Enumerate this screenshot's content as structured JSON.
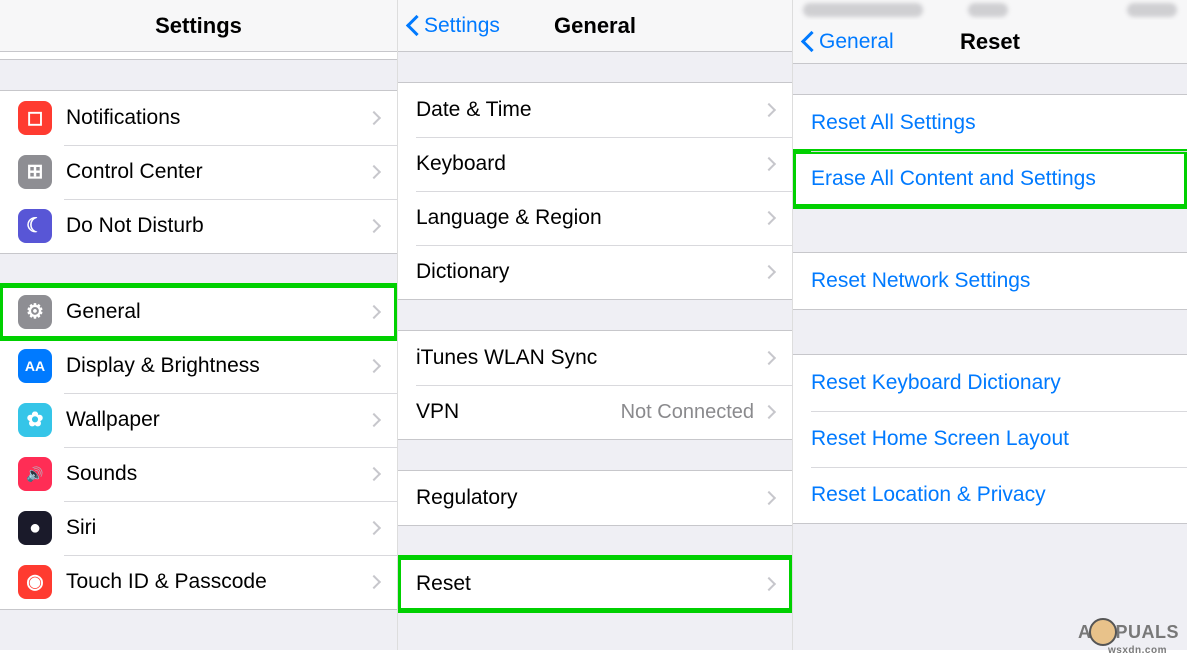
{
  "panel1": {
    "title": "Settings",
    "group1": [
      {
        "icon": "notifications-icon",
        "color": "#ff3b30",
        "glyph": "◻",
        "label": "Notifications"
      },
      {
        "icon": "control-center-icon",
        "color": "#8e8e93",
        "glyph": "⊞",
        "label": "Control Center"
      },
      {
        "icon": "dnd-icon",
        "color": "#5856d6",
        "glyph": "☾",
        "label": "Do Not Disturb"
      }
    ],
    "group2": [
      {
        "icon": "general-icon",
        "color": "#8e8e93",
        "glyph": "⚙",
        "label": "General",
        "highlight": true
      },
      {
        "icon": "display-icon",
        "color": "#007aff",
        "glyph": "AA",
        "label": "Display & Brightness"
      },
      {
        "icon": "wallpaper-icon",
        "color": "#35c5e8",
        "glyph": "✿",
        "label": "Wallpaper"
      },
      {
        "icon": "sounds-icon",
        "color": "#ff2d55",
        "glyph": "🔊",
        "label": "Sounds"
      },
      {
        "icon": "siri-icon",
        "color": "#1a1a2a",
        "glyph": "●",
        "label": "Siri"
      },
      {
        "icon": "touchid-icon",
        "color": "#ff3b30",
        "glyph": "◉",
        "label": "Touch ID & Passcode"
      }
    ]
  },
  "panel2": {
    "back": "Settings",
    "title": "General",
    "group1": [
      {
        "label": "Date & Time"
      },
      {
        "label": "Keyboard"
      },
      {
        "label": "Language & Region"
      },
      {
        "label": "Dictionary"
      }
    ],
    "group2": [
      {
        "label": "iTunes WLAN Sync"
      },
      {
        "label": "VPN",
        "value": "Not Connected"
      }
    ],
    "group3": [
      {
        "label": "Regulatory"
      }
    ],
    "group4": [
      {
        "label": "Reset",
        "highlight": true
      }
    ]
  },
  "panel3": {
    "back": "General",
    "title": "Reset",
    "group1": [
      {
        "label": "Reset All Settings"
      },
      {
        "label": "Erase All Content and Settings",
        "highlight": true
      }
    ],
    "group2": [
      {
        "label": "Reset Network Settings"
      }
    ],
    "group3": [
      {
        "label": "Reset Keyboard Dictionary"
      },
      {
        "label": "Reset Home Screen Layout"
      },
      {
        "label": "Reset Location & Privacy"
      }
    ]
  },
  "watermark": {
    "pre": "A",
    "post": "PUALS",
    "sub": "wsxdn.com"
  }
}
